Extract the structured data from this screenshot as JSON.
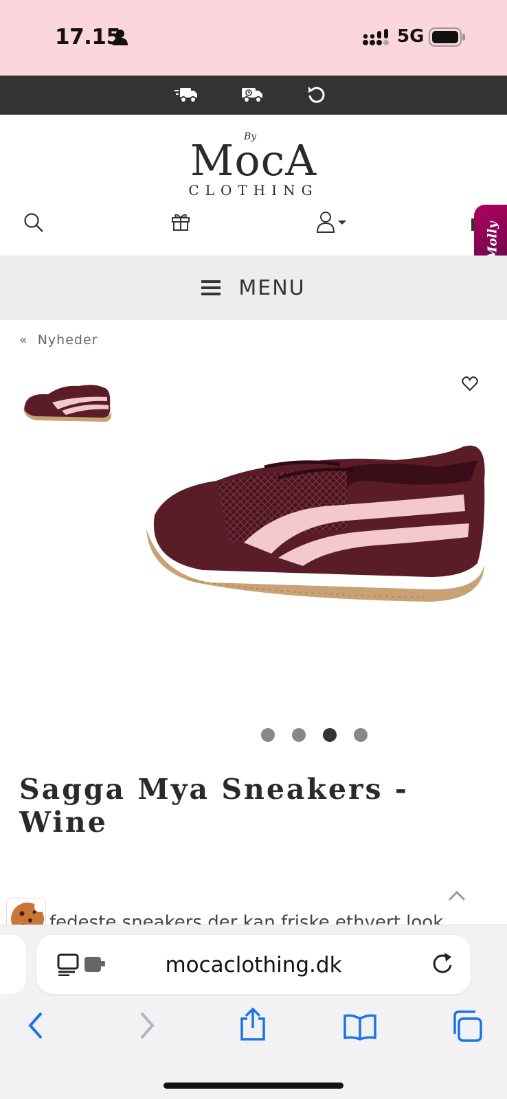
{
  "status_bar": {
    "time": "17.15",
    "network": "5G"
  },
  "brand": {
    "by": "By",
    "name": "MocA",
    "sub": "CLOTHING"
  },
  "menu": {
    "label": "MENU"
  },
  "molly_widget": {
    "label": "Molly"
  },
  "breadcrumb": {
    "arrow": "«",
    "label": "Nyheder"
  },
  "product": {
    "title": "Sagga Mya Sneakers - Wine",
    "description_partial": "fedeste sneakers der kan friske ethvert look",
    "carousel": {
      "total": 4,
      "active_index": 3
    }
  },
  "browser": {
    "url": "mocaclothing.dk"
  },
  "colors": {
    "status_bg": "#fbd6dc",
    "topbar_bg": "#333333",
    "menu_bg": "#eceded",
    "accent_ios": "#1a73e8",
    "molly": "#b0005e",
    "shoe": "#5a1d27",
    "stripe": "#f3c9cf",
    "sole": "#c8a274"
  }
}
